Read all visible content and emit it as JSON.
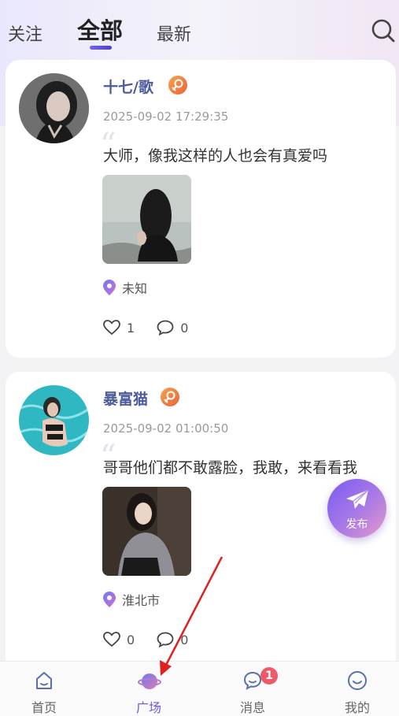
{
  "header": {
    "tabs": [
      {
        "label": "关注"
      },
      {
        "label": "全部",
        "active": true
      },
      {
        "label": "最新"
      }
    ],
    "search_icon": "search-icon"
  },
  "posts": [
    {
      "username": "十七/歌",
      "gender_icon": "female-icon",
      "timestamp": "2025-09-02 17:29:35",
      "text": "大师，像我这样的人也会有真爱吗",
      "location": "未知",
      "likes": "1",
      "comments": "0"
    },
    {
      "username": "暴富猫",
      "gender_icon": "female-icon",
      "timestamp": "2025-09-02 01:00:50",
      "text": "哥哥他们都不敢露脸，我敢，来看看我",
      "location": "淮北市",
      "likes": "0",
      "comments": "0"
    }
  ],
  "fab": {
    "label": "发布",
    "icon": "paper-plane-icon"
  },
  "bottom_nav": [
    {
      "label": "首页",
      "icon": "home-icon"
    },
    {
      "label": "广场",
      "icon": "planet-icon",
      "active": true
    },
    {
      "label": "消息",
      "icon": "chat-icon",
      "badge": "1"
    },
    {
      "label": "我的",
      "icon": "smile-icon"
    }
  ],
  "colors": {
    "accent": "#6a5bd8",
    "username": "#4a5a9c",
    "badge": "#ee5a67",
    "annotation_arrow": "#e02020"
  }
}
